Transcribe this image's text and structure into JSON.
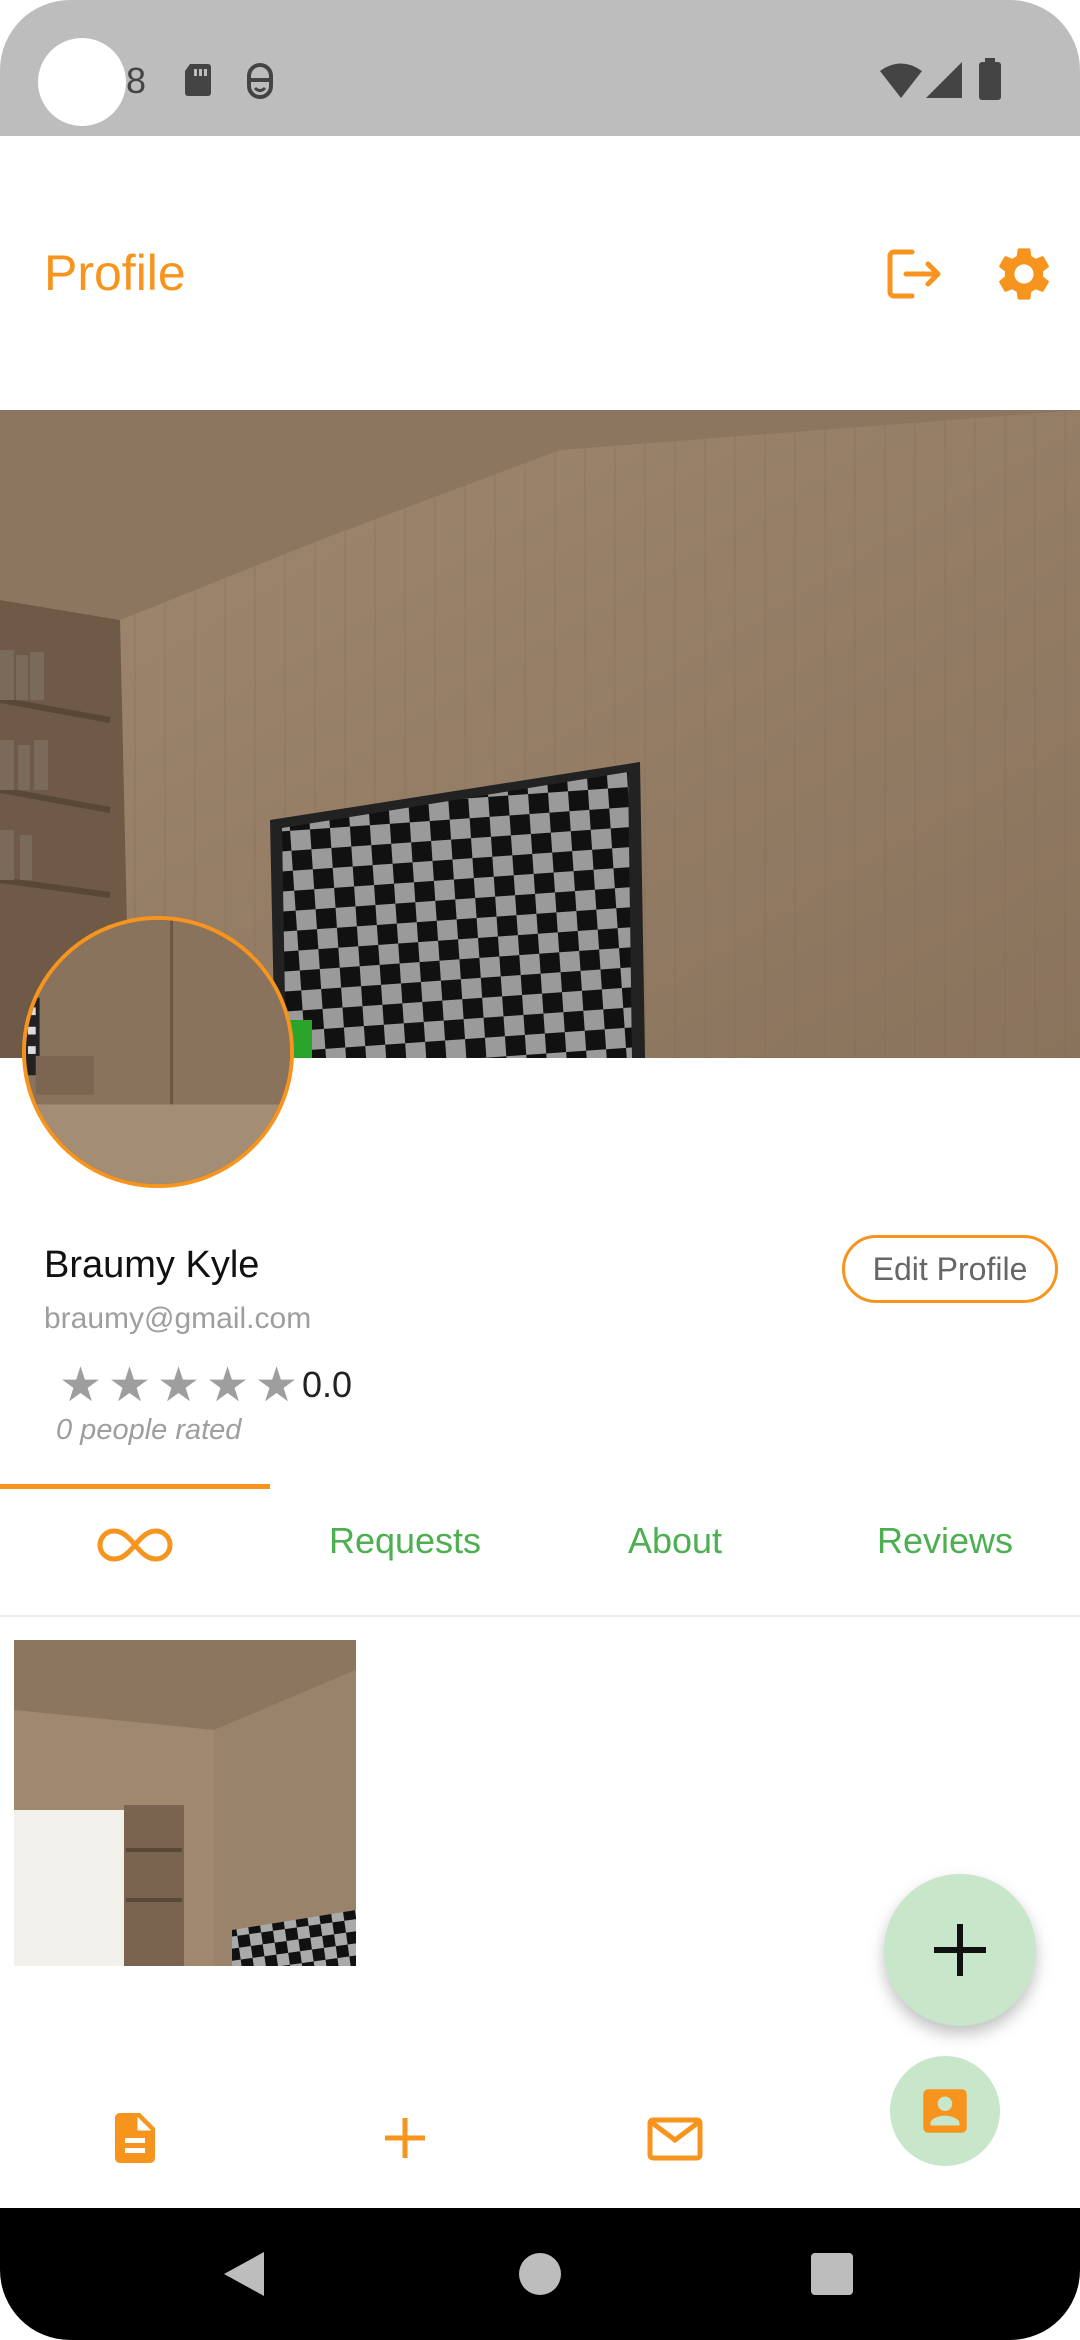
{
  "status_bar": {
    "notification_count": "8",
    "icons": [
      "sd-card-icon",
      "vpn-icon",
      "wifi-icon",
      "signal-icon",
      "battery-icon"
    ]
  },
  "header": {
    "title": "Profile",
    "icons": [
      "logout-icon",
      "gear-icon"
    ]
  },
  "profile": {
    "name": "Braumy Kyle",
    "email": "braumy@gmail.com",
    "edit_label": "Edit Profile",
    "rating_value": "0.0",
    "stars": 5,
    "rated_text": "0 people rated"
  },
  "tabs": [
    {
      "label": "",
      "icon": "infinity-icon",
      "selected": true
    },
    {
      "label": "Requests",
      "selected": false
    },
    {
      "label": "About",
      "selected": false
    },
    {
      "label": "Reviews",
      "selected": false
    }
  ],
  "bottom_nav": [
    "posts-icon",
    "add-icon",
    "mail-icon",
    "profile-icon"
  ],
  "colors": {
    "accent": "#f7941d",
    "tab_text": "#4caf50",
    "fab": "#c8e6c9",
    "status_bar": "#bdbdbd"
  }
}
